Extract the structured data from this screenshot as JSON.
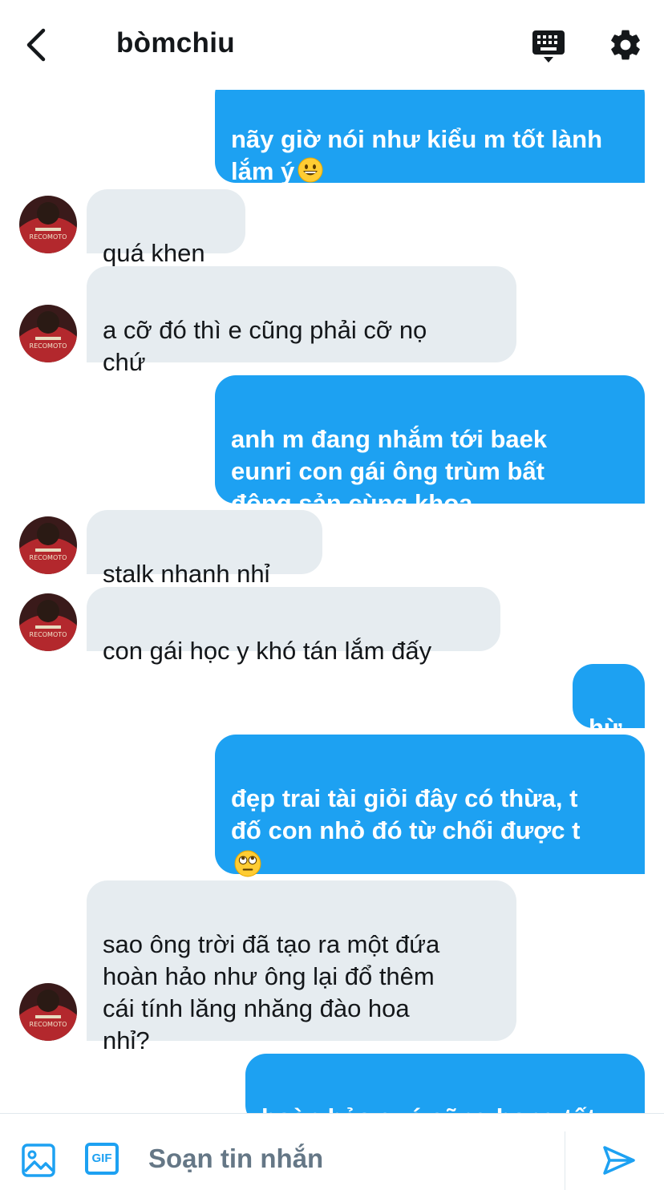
{
  "header": {
    "title": "bòmchiu",
    "back_icon": "chevron-left-icon",
    "keyboard_icon": "keyboard-icon",
    "settings_icon": "gear-icon"
  },
  "messages": [
    {
      "sender": "me",
      "text": "nãy giờ nói như kiểu m tốt lành\nlắm ý",
      "emoji": "grinning-face"
    },
    {
      "sender": "them",
      "text": "quá khen"
    },
    {
      "sender": "them",
      "text": "a cỡ đó thì e cũng phải cỡ nọ\nchứ"
    },
    {
      "sender": "me",
      "text": "anh m đang nhắm tới baek\neunri con gái ông trùm bất\nđộng sản cùng khoa"
    },
    {
      "sender": "them",
      "text": "stalk nhanh nhỉ"
    },
    {
      "sender": "them",
      "text": "con gái học y khó tán lắm đấy"
    },
    {
      "sender": "me",
      "text": "hừ"
    },
    {
      "sender": "me",
      "text": "đẹp trai tài giỏi đây có thừa, t\nđố con nhỏ đó từ chối được t",
      "emoji": "face-with-rolling-eyes"
    },
    {
      "sender": "them",
      "text": "sao ông trời đã tạo ra một đứa\nhoàn hảo như ông lại đổ thêm\ncái tính lăng nhăng đào hoa\nnhỉ?"
    },
    {
      "sender": "me",
      "text": "hoàn hảo quá cũng hong tốt"
    }
  ],
  "composer": {
    "placeholder": "Soạn tin nhắn",
    "gif_label": "GIF",
    "image_icon": "image-icon",
    "send_icon": "send-icon"
  },
  "colors": {
    "accent": "#1da1f2",
    "received_bubble": "#e6ecf0",
    "text_dark": "#14171a",
    "placeholder": "#657786"
  }
}
